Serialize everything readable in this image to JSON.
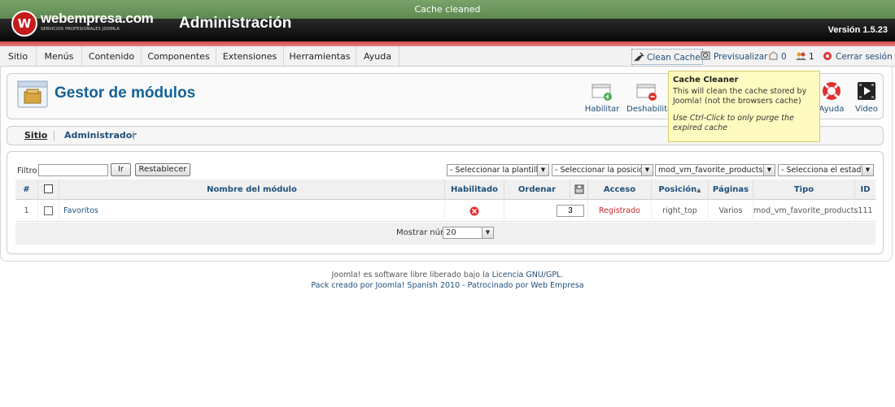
{
  "status": {
    "message": "Cache cleaned"
  },
  "header": {
    "logo_mark": "W",
    "logo_name": "webempresa.com",
    "logo_tagline": "SERVICIOS PROFESIONALES JOOMLA",
    "title": "Administración",
    "version": "Versión 1.5.23"
  },
  "menu": {
    "items": [
      "Sitio",
      "Menús",
      "Contenido",
      "Componentes",
      "Extensiones",
      "Herramientas",
      "Ayuda"
    ],
    "clean_cache": "Clean Cache",
    "preview": "Previsualizar",
    "messages_count": "0",
    "users_count": "1",
    "logout": "Cerrar sesión"
  },
  "toolbar": {
    "title": "Gestor de módulos",
    "buttons": {
      "enable": "Habilitar",
      "disable": "Deshabilitar",
      "help": "Ayuda",
      "video": "Video"
    }
  },
  "tooltip": {
    "title": "Cache Cleaner",
    "description": "This will clean the cache stored by Joomla! (not the browsers cache)",
    "note": "Use Ctrl-Click to only purge the expired cache"
  },
  "subtabs": [
    "Sitio",
    "Administrador"
  ],
  "filter": {
    "label": "Filtro:",
    "value": "",
    "go": "Ir",
    "reset": "Restablecer",
    "selects": [
      "- Seleccionar la plantilla -",
      "- Seleccionar la posición -",
      "mod_vm_favorite_products",
      "- Selecciona el estado -"
    ]
  },
  "table": {
    "headers": {
      "num": "#",
      "name": "Nombre del módulo",
      "enabled": "Habilitado",
      "order": "Ordenar",
      "access": "Acceso",
      "position": "Posición",
      "pages": "Páginas",
      "type": "Tipo",
      "id": "ID"
    },
    "rows": [
      {
        "num": "1",
        "name": "Favoritos",
        "order": "3",
        "access": "Registrado",
        "position": "right_top",
        "pages": "Varios",
        "type": "mod_vm_favorite_products",
        "id": "111"
      }
    ],
    "footer_label": "Mostrar núm.",
    "footer_value": "20"
  },
  "footer": {
    "line1_pre": "Joomla! es software libre liberado bajo la ",
    "line1_link": "Licencia GNU/GPL",
    "line1_post": ".",
    "line2": "Pack creado por Joomla! Spanish 2010 - Patrocinado por Web Empresa"
  },
  "colors": {
    "accent": "#146295",
    "status_green": "#6a9a5c",
    "header_red": "#d24a4a",
    "disabled_red": "#e03030",
    "tooltip_bg": "#fffbc0"
  }
}
